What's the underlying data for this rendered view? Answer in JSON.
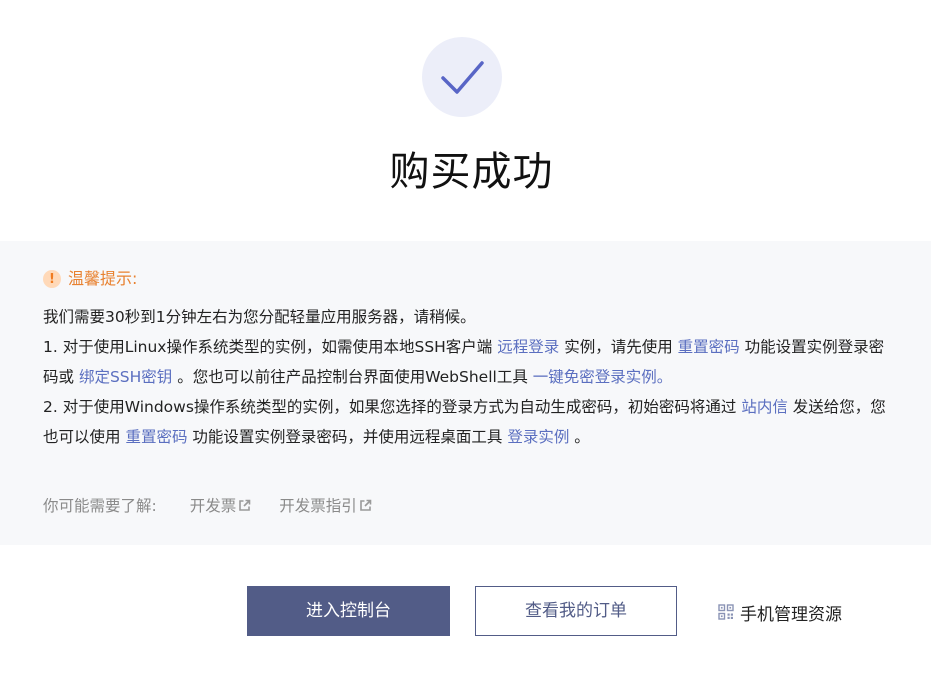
{
  "success": {
    "title": "购买成功"
  },
  "tips": {
    "title": "温馨提示:",
    "line1": "我们需要30秒到1分钟左右为您分配轻量应用服务器，请稍候。",
    "item1": {
      "t1": "1. 对于使用Linux操作系统类型的实例，如需使用本地SSH客户端 ",
      "link1": "远程登录",
      "t2": " 实例，请先使用 ",
      "link2": "重置密码",
      "t3": " 功能设置实例登录密码或 ",
      "link3": "绑定SSH密钥",
      "t4": " 。您也可以前往产品控制台界面使用WebShell工具 ",
      "link4": "一键免密登录实例。"
    },
    "item2": {
      "t1": "2. 对于使用Windows操作系统类型的实例，如果您选择的登录方式为自动生成密码，初始密码将通过 ",
      "link1": "站内信",
      "t2": " 发送给您，您也可以使用 ",
      "link2": "重置密码",
      "t3": " 功能设置实例登录密码，并使用远程桌面工具 ",
      "link3": "登录实例",
      "t4": " 。"
    }
  },
  "resources": {
    "label": "你可能需要了解:",
    "links": [
      "开发票",
      "开发票指引"
    ]
  },
  "actions": {
    "console": "进入控制台",
    "orders": "查看我的订单",
    "mobile": "手机管理资源"
  },
  "colors": {
    "primary": "#525c87",
    "link": "#5b6fc0",
    "warning": "#e8812f",
    "panel_bg": "#f7f8fa",
    "check": "#5865c6"
  },
  "icons": {
    "success": "checkmark-icon",
    "warning": "exclamation-icon",
    "external": "external-link-icon",
    "qr": "qr-code-icon"
  }
}
